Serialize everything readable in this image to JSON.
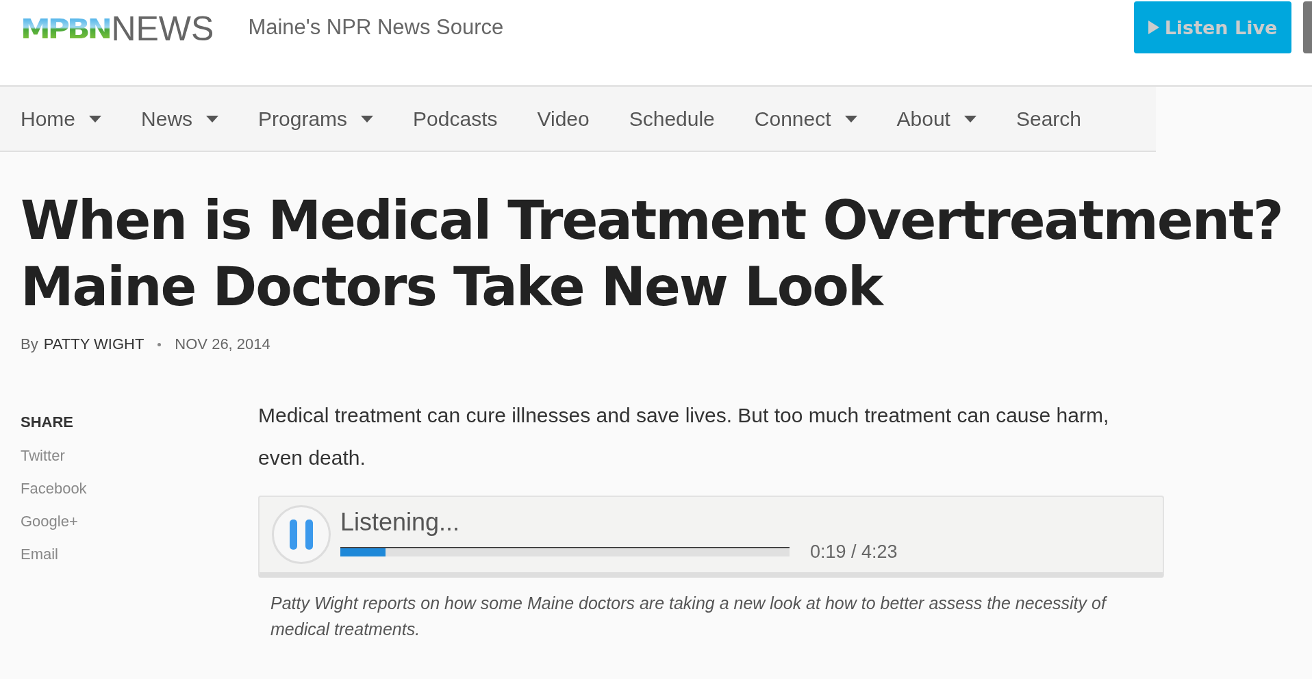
{
  "header": {
    "logo_mark": "MPBN",
    "logo_text": "NEWS",
    "tagline": "Maine's NPR News Source",
    "listen_button": "Listen Live"
  },
  "nav": [
    {
      "label": "Home",
      "dropdown": true
    },
    {
      "label": "News",
      "dropdown": true
    },
    {
      "label": "Programs",
      "dropdown": true
    },
    {
      "label": "Podcasts",
      "dropdown": false
    },
    {
      "label": "Video",
      "dropdown": false
    },
    {
      "label": "Schedule",
      "dropdown": false
    },
    {
      "label": "Connect",
      "dropdown": true
    },
    {
      "label": "About",
      "dropdown": true
    },
    {
      "label": "Search",
      "dropdown": false
    }
  ],
  "article": {
    "title": "When is Medical Treatment Overtreatment? Maine Doctors Take New Look",
    "byline_prefix": "By",
    "author": "PATTY WIGHT",
    "date": "NOV 26, 2014",
    "share": {
      "heading": "SHARE",
      "links": [
        "Twitter",
        "Facebook",
        "Google+",
        "Email"
      ]
    },
    "summary": "Medical treatment can cure illnesses and save lives. But too much treatment can cause harm, even death.",
    "player": {
      "status": "Listening...",
      "level": 0.1,
      "time": "0:19 / 4:23"
    },
    "caption": "Patty Wight reports on how some Maine doctors are taking a new look at how to better assess the necessity of medical treatments."
  }
}
